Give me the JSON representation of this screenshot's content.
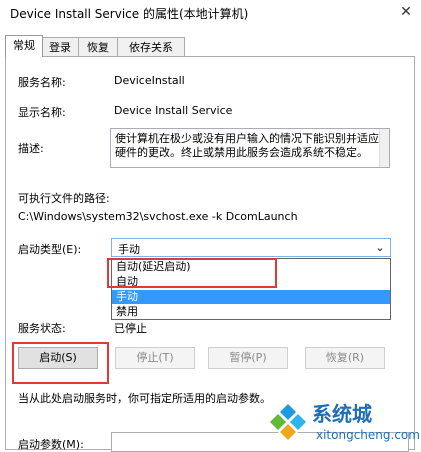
{
  "window": {
    "title": "Device Install Service 的属性(本地计算机)"
  },
  "tabs": [
    {
      "label": "常规"
    },
    {
      "label": "登录"
    },
    {
      "label": "恢复"
    },
    {
      "label": "依存关系"
    }
  ],
  "general": {
    "service_name_label": "服务名称:",
    "service_name": "DeviceInstall",
    "display_name_label": "显示名称:",
    "display_name": "Device Install Service",
    "description_label": "描述:",
    "description": "使计算机在极少或没有用户输入的情况下能识别并适应硬件的更改。终止或禁用此服务会造成系统不稳定。",
    "exe_path_label": "可执行文件的路径:",
    "exe_path": "C:\\Windows\\system32\\svchost.exe -k DcomLaunch",
    "startup_type_label": "启动类型(E):",
    "startup_type_value": "手动",
    "startup_options": [
      "自动(延迟启动)",
      "自动",
      "手动",
      "禁用"
    ],
    "startup_selected_index": 2,
    "service_status_label": "服务状态:",
    "service_status": "已停止",
    "buttons": {
      "start": "启动(S)",
      "stop": "停止(T)",
      "pause": "暂停(P)",
      "resume": "恢复(R)"
    },
    "hint": "当从此处启动服务时，你可指定所适用的启动参数。",
    "start_params_label": "启动参数(M):",
    "start_params_value": ""
  },
  "watermark": {
    "name": "系统城",
    "url": "xitongcheng.com"
  }
}
